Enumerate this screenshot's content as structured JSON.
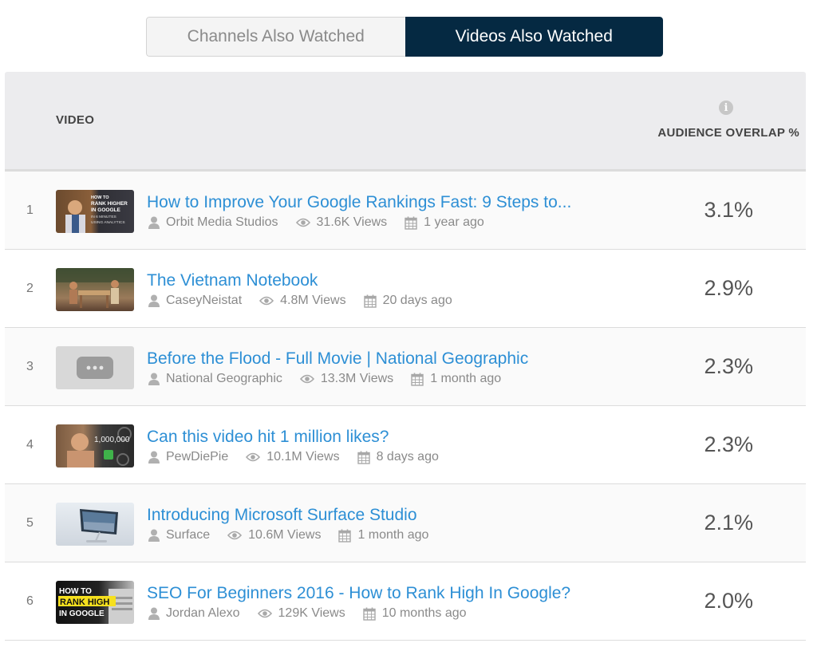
{
  "tabs": {
    "channels": "Channels Also Watched",
    "videos": "Videos Also Watched"
  },
  "table": {
    "col_video": "VIDEO",
    "col_overlap": "AUDIENCE OVERLAP %",
    "info_icon_glyph": "i"
  },
  "colors": {
    "active_tab": "#052942",
    "link": "#2d8fd5"
  },
  "rows": [
    {
      "rank": "1",
      "title": "How to Improve Your Google Rankings Fast: 9 Steps to...",
      "channel": "Orbit Media Studios",
      "views": "31.6K Views",
      "date": "1 year ago",
      "overlap": "3.1%",
      "thumb_text": [
        "HOW TO",
        "RANK HIGHER",
        "IN GOOGLE",
        "IN 6 MINUTES",
        "USING ANALYTICS"
      ]
    },
    {
      "rank": "2",
      "title": "The Vietnam Notebook",
      "channel": "CaseyNeistat",
      "views": "4.8M Views",
      "date": "20 days ago",
      "overlap": "2.9%"
    },
    {
      "rank": "3",
      "title": "Before the Flood - Full Movie | National Geographic",
      "channel": "National Geographic",
      "views": "13.3M Views",
      "date": "1 month ago",
      "overlap": "2.3%"
    },
    {
      "rank": "4",
      "title": "Can this video hit 1 million likes?",
      "channel": "PewDiePie",
      "views": "10.1M Views",
      "date": "8 days ago",
      "overlap": "2.3%",
      "thumb_text": [
        "1,000,000"
      ]
    },
    {
      "rank": "5",
      "title": "Introducing Microsoft Surface Studio",
      "channel": "Surface",
      "views": "10.6M Views",
      "date": "1 month ago",
      "overlap": "2.1%"
    },
    {
      "rank": "6",
      "title": "SEO For Beginners 2016 - How to Rank High In Google?",
      "channel": "Jordan Alexo",
      "views": "129K Views",
      "date": "10 months ago",
      "overlap": "2.0%",
      "thumb_text": [
        "HOW TO",
        "RANK HIGH",
        "IN GOOGLE"
      ]
    }
  ]
}
